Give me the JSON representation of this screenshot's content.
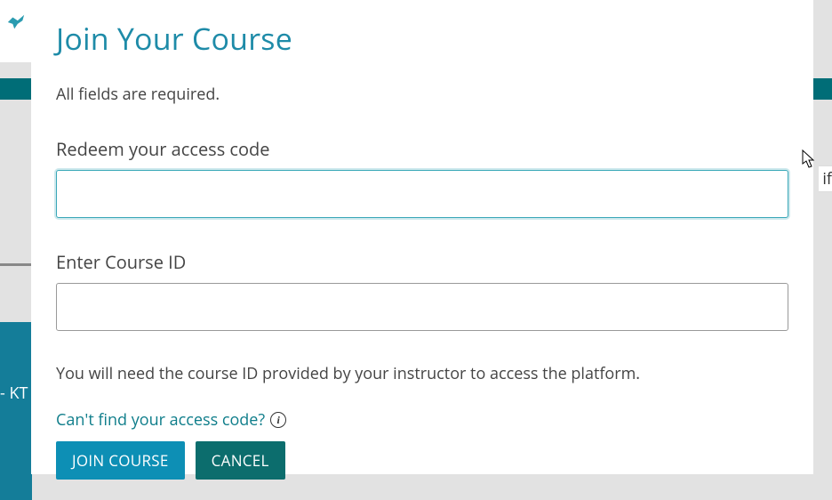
{
  "bg": {
    "left_fragment": "- KT",
    "right_fragment": "if"
  },
  "modal": {
    "title": "Join Your Course",
    "required_note": "All fields are required.",
    "fields": {
      "access_code": {
        "label": "Redeem your access code",
        "value": ""
      },
      "course_id": {
        "label": "Enter Course ID",
        "value": ""
      }
    },
    "helper": "You will need the course ID provided by your instructor to access the platform.",
    "help_link": "Can't find your access code?",
    "buttons": {
      "join": "JOIN COURSE",
      "cancel": "CANCEL"
    }
  }
}
